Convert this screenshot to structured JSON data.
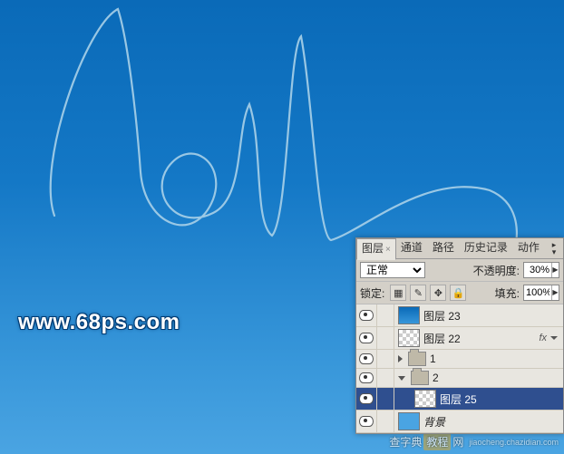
{
  "canvas": {
    "watermark_url": "www.68ps.com",
    "watermark_site_left": "查字典",
    "watermark_site_mid": "教程",
    "watermark_site_right": "网",
    "watermark_site_domain": "jiaocheng.chazidian.com"
  },
  "panel": {
    "tabs": {
      "layers": "图层",
      "channels": "通道",
      "paths": "路径",
      "history": "历史记录",
      "actions": "动作"
    },
    "blend_mode": "正常",
    "opacity_label": "不透明度:",
    "opacity_value": "30%",
    "lock_label": "锁定:",
    "fill_label": "填充:",
    "fill_value": "100%",
    "fx_label": "fx"
  },
  "layers": [
    {
      "id": "l23",
      "type": "layer",
      "name": "图层 23",
      "visible": true,
      "thumb": "grad",
      "indent": 0,
      "fx": false
    },
    {
      "id": "l22",
      "type": "layer",
      "name": "图层 22",
      "visible": true,
      "thumb": "checker",
      "indent": 0,
      "fx": true
    },
    {
      "id": "g1",
      "type": "group",
      "name": "1",
      "visible": true,
      "open": false,
      "indent": 0
    },
    {
      "id": "g2",
      "type": "group",
      "name": "2",
      "visible": true,
      "open": true,
      "indent": 0
    },
    {
      "id": "l25",
      "type": "layer",
      "name": "图层 25",
      "visible": true,
      "thumb": "checker",
      "indent": 1,
      "selected": true
    },
    {
      "id": "bg",
      "type": "bg",
      "name": "背景",
      "visible": true,
      "thumb": "solid-blue",
      "indent": 0
    }
  ]
}
